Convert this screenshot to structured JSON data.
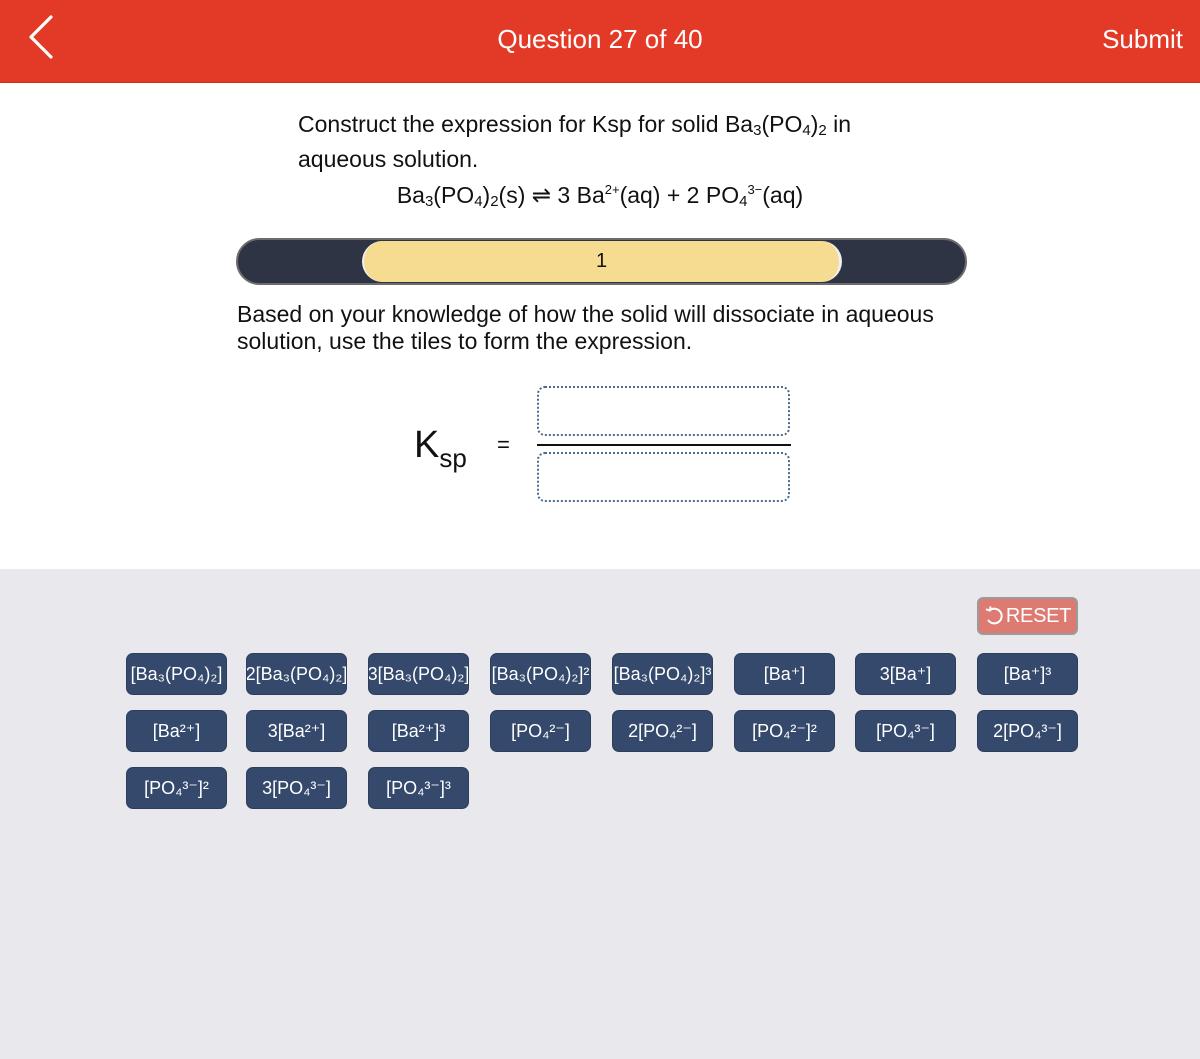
{
  "header": {
    "back_icon": "chevron-left-icon",
    "title": "Question 27 of 40",
    "submit_label": "Submit"
  },
  "question": {
    "prompt_pre": "Construct the expression for Ksp for solid Ba",
    "prompt_formula_sub1": "3",
    "prompt_formula_mid": "(PO",
    "prompt_formula_sub2": "4",
    "prompt_formula_close": ")",
    "prompt_formula_sub3": "2",
    "prompt_post": " in aqueous solution.",
    "equation": {
      "reactant": "Ba3(PO4)2(s)",
      "arrow": "⇌",
      "products": "3 Ba2+(aq) + 2 PO43−(aq)"
    },
    "step": {
      "current": "1",
      "progress_fraction": 0.66
    },
    "instruction": "Based on your knowledge of how the solid will dissociate in aqueous solution, use the tiles to form the expression."
  },
  "expression": {
    "lhs_main": "K",
    "lhs_sub": "sp",
    "equals": "=",
    "numerator": "",
    "denominator": ""
  },
  "tray": {
    "reset_label": "RESET",
    "reset_icon": "undo-icon",
    "tiles": [
      {
        "coef": "",
        "base": "[Ba₃(PO₄)₂]",
        "exp": ""
      },
      {
        "coef": "2",
        "base": "[Ba₃(PO₄)₂]",
        "exp": ""
      },
      {
        "coef": "3",
        "base": "[Ba₃(PO₄)₂]",
        "exp": ""
      },
      {
        "coef": "",
        "base": "[Ba₃(PO₄)₂]",
        "exp": "2"
      },
      {
        "coef": "",
        "base": "[Ba₃(PO₄)₂]",
        "exp": "3"
      },
      {
        "coef": "",
        "base": "[Ba⁺]",
        "exp": ""
      },
      {
        "coef": "3",
        "base": "[Ba⁺]",
        "exp": ""
      },
      {
        "coef": "",
        "base": "[Ba⁺]",
        "exp": "3"
      },
      {
        "coef": "",
        "base": "[Ba²⁺]",
        "exp": ""
      },
      {
        "coef": "3",
        "base": "[Ba²⁺]",
        "exp": ""
      },
      {
        "coef": "",
        "base": "[Ba²⁺]",
        "exp": "3"
      },
      {
        "coef": "",
        "base": "[PO₄²⁻]",
        "exp": ""
      },
      {
        "coef": "2",
        "base": "[PO₄²⁻]",
        "exp": ""
      },
      {
        "coef": "",
        "base": "[PO₄²⁻]",
        "exp": "2"
      },
      {
        "coef": "",
        "base": "[PO₄³⁻]",
        "exp": ""
      },
      {
        "coef": "2",
        "base": "[PO₄³⁻]",
        "exp": ""
      },
      {
        "coef": "",
        "base": "[PO₄³⁻]",
        "exp": "2"
      },
      {
        "coef": "3",
        "base": "[PO₄³⁻]",
        "exp": ""
      },
      {
        "coef": "",
        "base": "[PO₄³⁻]",
        "exp": "3"
      }
    ],
    "tile_labels": [
      "[Ba₃(PO₄)₂]",
      "2[Ba₃(PO₄)₂]",
      "3[Ba₃(PO₄)₂]",
      "[Ba₃(PO₄)₂]²",
      "[Ba₃(PO₄)₂]³",
      "[Ba⁺]",
      "3[Ba⁺]",
      "[Ba⁺]³",
      "[Ba²⁺]",
      "3[Ba²⁺]",
      "[Ba²⁺]³",
      "[PO₄²⁻]",
      "2[PO₄²⁻]",
      "[PO₄²⁻]²",
      "[PO₄³⁻]",
      "2[PO₄³⁻]",
      "[PO₄³⁻]²",
      "3[PO₄³⁻]",
      "[PO₄³⁻]³"
    ]
  },
  "colors": {
    "header_bg": "#e33a28",
    "tile_bg": "#34496b",
    "reset_bg": "#dd7a72",
    "tray_bg": "#e9e8ed",
    "step_track": "#2f3444",
    "step_thumb": "#f5dc90"
  }
}
